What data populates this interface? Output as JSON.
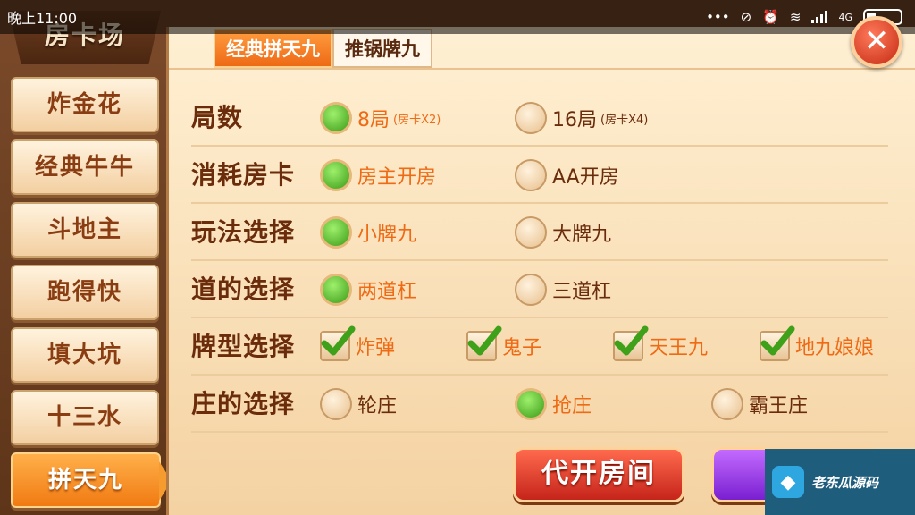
{
  "status": {
    "time": "晚上11:00",
    "network": "4G",
    "icons": [
      "more-dots-icon",
      "vibrate-off-icon",
      "alarm-icon",
      "wifi-icon",
      "signal-icon",
      "battery-icon"
    ]
  },
  "sidebar": {
    "title": "房卡场",
    "items": [
      {
        "label": "炸金花"
      },
      {
        "label": "经典牛牛"
      },
      {
        "label": "斗地主"
      },
      {
        "label": "跑得快"
      },
      {
        "label": "填大坑"
      },
      {
        "label": "十三水"
      },
      {
        "label": "拼天九",
        "active": true
      }
    ]
  },
  "tabs": [
    {
      "label": "经典拼天九",
      "active": true
    },
    {
      "label": "推锅牌九",
      "active": false
    }
  ],
  "close": {
    "label": "✕"
  },
  "rows": [
    {
      "label": "局数",
      "options": [
        {
          "text": "8局",
          "sub": "(房卡X2)",
          "selected": true
        },
        {
          "text": "16局",
          "sub": "(房卡X4)",
          "selected": false
        }
      ]
    },
    {
      "label": "消耗房卡",
      "options": [
        {
          "text": "房主开房",
          "selected": true
        },
        {
          "text": "AA开房",
          "selected": false
        }
      ]
    },
    {
      "label": "玩法选择",
      "options": [
        {
          "text": "小牌九",
          "selected": true
        },
        {
          "text": "大牌九",
          "selected": false
        }
      ]
    },
    {
      "label": "道的选择",
      "options": [
        {
          "text": "两道杠",
          "selected": true
        },
        {
          "text": "三道杠",
          "selected": false
        }
      ]
    },
    {
      "label": "牌型选择",
      "options": [
        {
          "text": "炸弹",
          "checked": true
        },
        {
          "text": "鬼子",
          "checked": true
        },
        {
          "text": "天王九",
          "checked": true
        },
        {
          "text": "地九娘娘",
          "checked": true
        }
      ]
    },
    {
      "label": "庄的选择",
      "options": [
        {
          "text": "轮庄",
          "selected": false
        },
        {
          "text": "抢庄",
          "selected": true
        },
        {
          "text": "霸王庄",
          "selected": false
        }
      ]
    }
  ],
  "buttons": {
    "proxy_open": "代开房间"
  },
  "watermark": {
    "text": "老东瓜源码"
  },
  "colors": {
    "accent": "#ee6a15",
    "text": "#6b2c0c",
    "selected": "#3a9a16"
  }
}
